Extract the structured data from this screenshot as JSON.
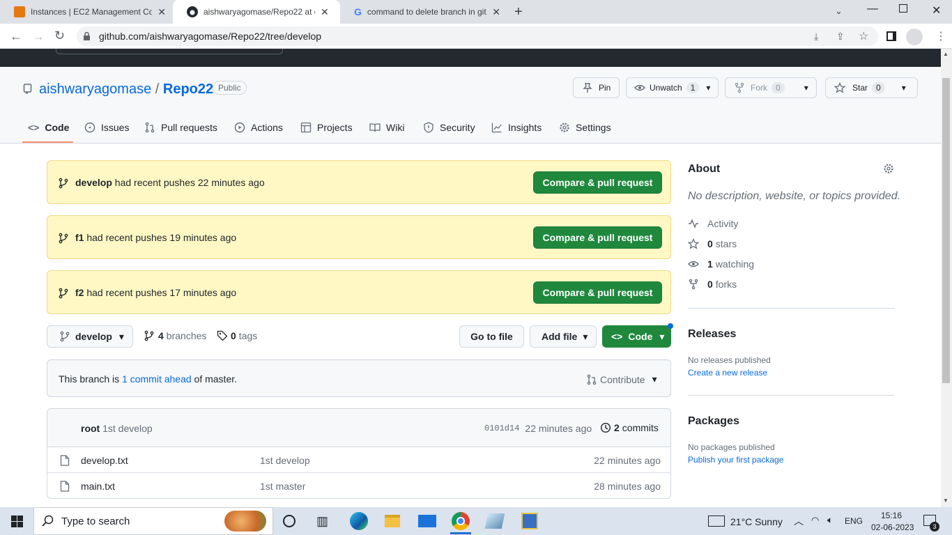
{
  "browser": {
    "tabs": [
      {
        "title": "Instances | EC2 Management Con"
      },
      {
        "title": "aishwaryagomase/Repo22 at dev"
      },
      {
        "title": "command to delete branch in git"
      }
    ],
    "url": "github.com/aishwaryagomase/Repo22/tree/develop"
  },
  "repo": {
    "owner": "aishwaryagomase",
    "name": "Repo22",
    "visibility": "Public",
    "pin_label": "Pin",
    "unwatch_label": "Unwatch",
    "unwatch_count": "1",
    "fork_label": "Fork",
    "fork_count": "0",
    "star_label": "Star",
    "star_count": "0"
  },
  "nav": [
    "Code",
    "Issues",
    "Pull requests",
    "Actions",
    "Projects",
    "Wiki",
    "Security",
    "Insights",
    "Settings"
  ],
  "flashes": [
    {
      "branch": "develop",
      "text": "had recent pushes 22 minutes ago",
      "button": "Compare & pull request"
    },
    {
      "branch": "f1",
      "text": "had recent pushes 19 minutes ago",
      "button": "Compare & pull request"
    },
    {
      "branch": "f2",
      "text": "had recent pushes 17 minutes ago",
      "button": "Compare & pull request"
    }
  ],
  "toolbar": {
    "branch": "develop",
    "branches_count": "4",
    "branches_label": "branches",
    "tags_count": "0",
    "tags_label": "tags",
    "go_to_file": "Go to file",
    "add_file": "Add file",
    "code": "Code"
  },
  "ahead": {
    "prefix": "This branch is",
    "link": "1 commit ahead",
    "suffix": "of master.",
    "contribute": "Contribute"
  },
  "commit": {
    "author": "root",
    "message": "1st develop",
    "sha": "0101d14",
    "time": "22 minutes ago",
    "commits_count": "2",
    "commits_label": "commits"
  },
  "files": [
    {
      "name": "develop.txt",
      "message": "1st develop",
      "time": "22 minutes ago"
    },
    {
      "name": "main.txt",
      "message": "1st master",
      "time": "28 minutes ago"
    }
  ],
  "sidebar": {
    "about": "About",
    "description": "No description, website, or topics provided.",
    "activity": "Activity",
    "stars_count": "0",
    "stars_label": "stars",
    "watching_count": "1",
    "watching_label": "watching",
    "forks_count": "0",
    "forks_label": "forks",
    "releases": "Releases",
    "no_releases": "No releases published",
    "create_release": "Create a new release",
    "packages": "Packages",
    "no_packages": "No packages published",
    "publish_package": "Publish your first package"
  },
  "taskbar": {
    "search_placeholder": "Type to search",
    "weather": "21°C  Sunny",
    "lang": "ENG",
    "time": "15:16",
    "date": "02-06-2023",
    "notif": "3"
  },
  "colors": {
    "green": "#1f883d",
    "link": "#0969da",
    "flash_bg": "#fff8c5",
    "accent": "#fd8c73"
  }
}
